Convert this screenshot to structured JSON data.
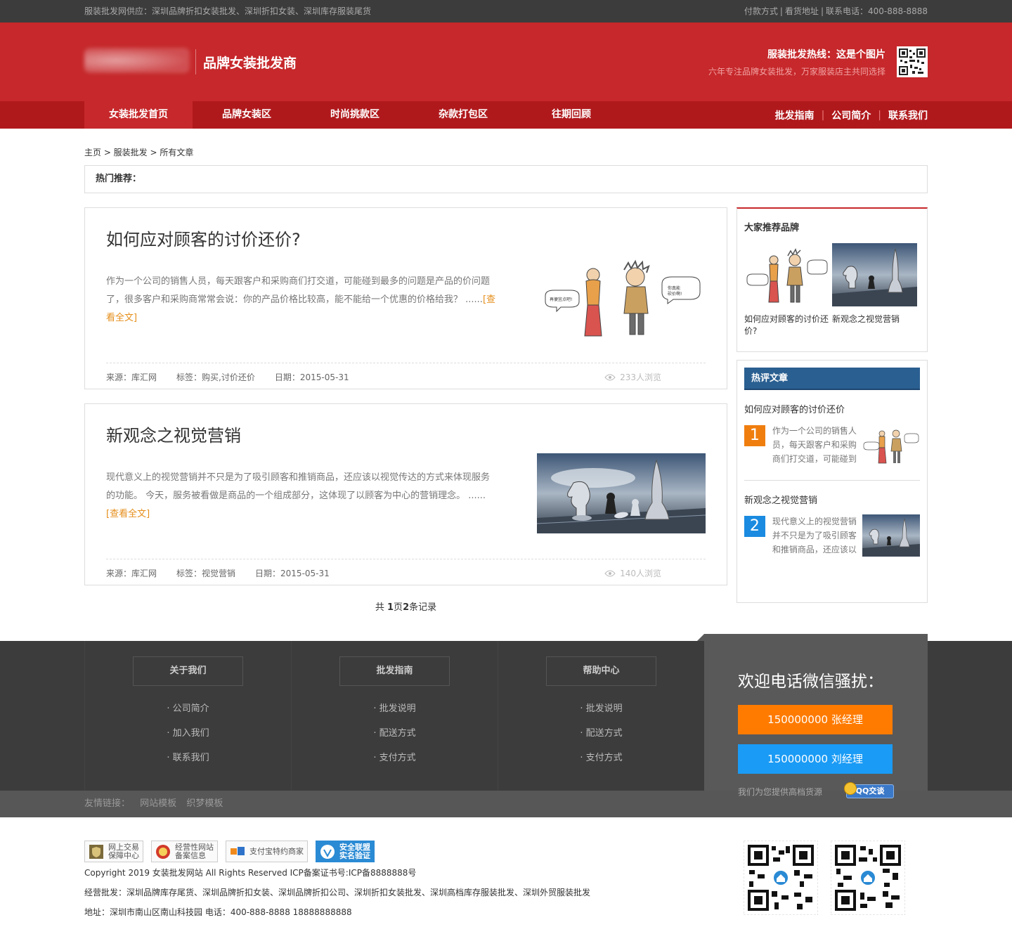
{
  "topbar": {
    "left": "服装批发网供应：深圳品牌折扣女装批发、深圳折扣女装、深圳库存服装尾货",
    "links": [
      "付款方式",
      "看货地址",
      "联系电话：400-888-8888"
    ]
  },
  "header": {
    "brand_title": "品牌女装批发商",
    "hotline_title": "服装批发热线：这是个图片",
    "hotline_sub": "六年专注品牌女装批发，万家服装店主共同选择"
  },
  "nav": {
    "items": [
      "女装批发首页",
      "品牌女装区",
      "时尚挑款区",
      "杂款打包区",
      "往期回顾"
    ],
    "right": [
      "批发指南",
      "公司简介",
      "联系我们"
    ]
  },
  "breadcrumb": "主页 > 服装批发 > 所有文章",
  "hot_recommend_label": "热门推荐：",
  "articles": [
    {
      "title": "如何应对顾客的讨价还价?",
      "summary": "作为一个公司的销售人员，每天跟客户和采购商们打交道，可能碰到最多的问题是产品的价问题了，很多客户和采购商常常会说：你的产品价格比较高，能不能给一个优惠的价格给我？ ......",
      "more": "[查看全文]",
      "source": "来源：库汇网",
      "tags": "标签：购买,讨价还价",
      "date": "日期：2015-05-31",
      "views": "233人浏览"
    },
    {
      "title": "新观念之视觉营销",
      "summary": "现代意义上的视觉营销并不只是为了吸引顾客和推销商品，还应该以视觉传达的方式来体现服务的功能。 今天，服务被看做是商品的一个组成部分，这体现了以顾客为中心的营销理念。 ......",
      "more": "[查看全文]",
      "source": "来源：库汇网",
      "tags": "标签：视觉营销",
      "date": "日期：2015-05-31",
      "views": "140人浏览"
    }
  ],
  "pager": {
    "prefix": "共 ",
    "pages": "1",
    "mid": "页",
    "count": "2",
    "suffix": "条记录"
  },
  "sidebar": {
    "brands_title": "大家推荐品牌",
    "brands": [
      "如何应对顾客的讨价还价?",
      "新观念之视觉营销"
    ],
    "hot_title": "热评文章",
    "hot": [
      {
        "title": "如何应对顾客的讨价还价",
        "num": "1",
        "text": "作为一个公司的销售人员，每天跟客户和采购商们打交道，可能碰到"
      },
      {
        "title": "新观念之视觉营销",
        "num": "2",
        "text": "现代意义上的视觉营销并不只是为了吸引顾客和推销商品，还应该以"
      }
    ]
  },
  "footer": {
    "cols": [
      {
        "title": "关于我们",
        "items": [
          "· 公司简介",
          "· 加入我们",
          "· 联系我们"
        ]
      },
      {
        "title": "批发指南",
        "items": [
          "· 批发说明",
          "· 配送方式",
          "· 支付方式"
        ]
      },
      {
        "title": "帮助中心",
        "items": [
          "· 批发说明",
          "· 配送方式",
          "· 支付方式"
        ]
      }
    ],
    "contact_title": "欢迎电话微信骚扰：",
    "phone1": "150000000 张经理",
    "phone2": "150000000 刘经理",
    "contact_note": "我们为您提供高档货源",
    "qq_label": "QQ交谈",
    "links_label": "友情链接：",
    "links": [
      "网站模板",
      "织梦模板"
    ],
    "badges": [
      {
        "l1": "网上交易",
        "l2": "保障中心"
      },
      {
        "l1": "经营性网站",
        "l2": "备案信息"
      },
      {
        "l1": "支付宝特约商家",
        "l2": ""
      },
      {
        "l1": "安全联盟",
        "l2": "实名验证"
      }
    ],
    "copyright": "Copyright 2019 女装批发网站 All Rights Reserved ICP备案证书号:ICP备8888888号",
    "business": "经营批发：深圳品牌库存尾货、深圳品牌折扣女装、深圳品牌折扣公司、深圳折扣女装批发、深圳高档库存服装批发、深圳外贸服装批发",
    "address": "地址：深圳市南山区南山科技园 电话：400-888-8888 18888888888"
  },
  "colors": {
    "brand_red": "#c6282b",
    "nav_red": "#b0191c",
    "link_orange": "#e58e1a",
    "hot_blue": "#2a5f91",
    "num1": "#f07e0f",
    "num2": "#1a8be0",
    "btn_orange": "#ff7b00",
    "btn_blue": "#1a9bf5"
  }
}
